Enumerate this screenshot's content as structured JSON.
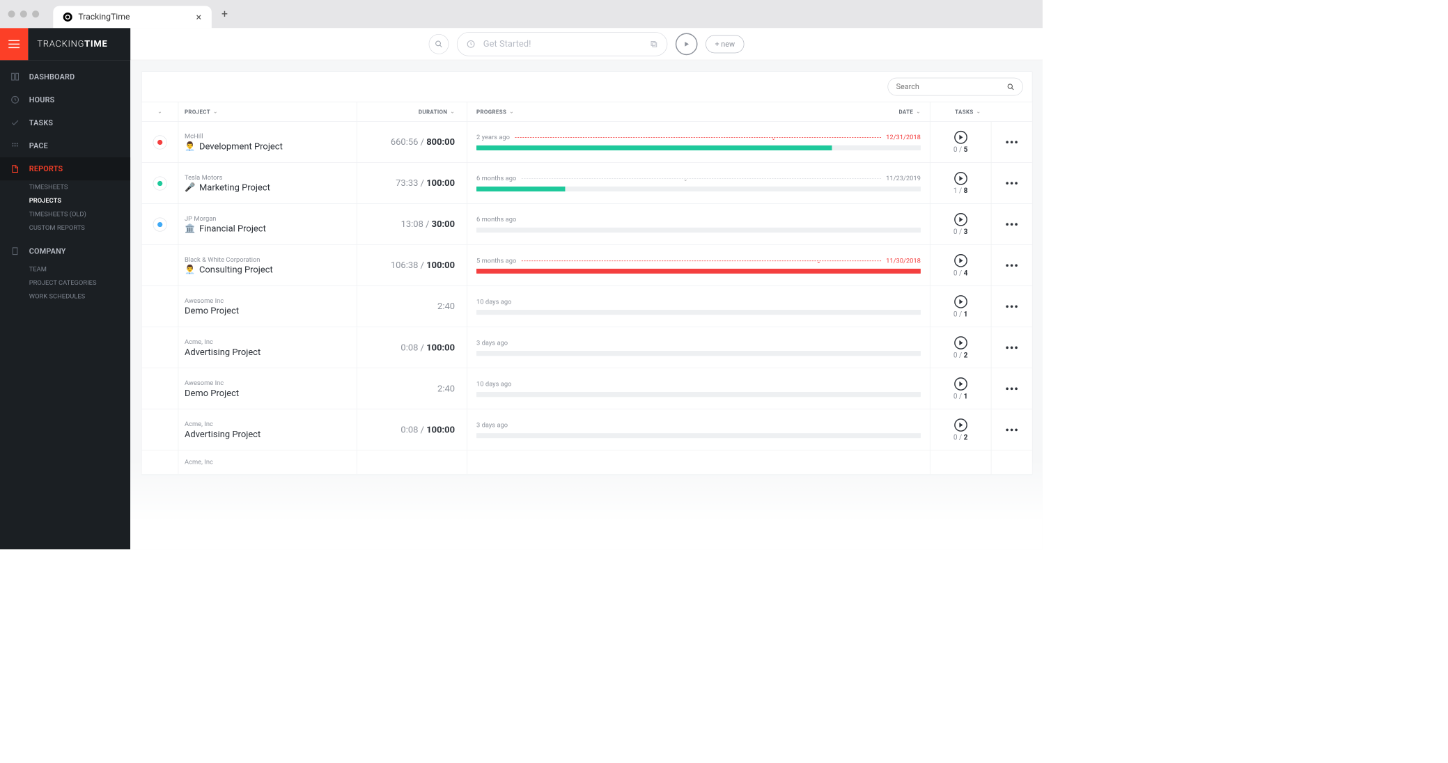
{
  "browser": {
    "tab_title": "TrackingTime"
  },
  "brand": {
    "part1": "TRACKING",
    "part2": "TIME"
  },
  "topbar": {
    "get_started": "Get Started!",
    "new_btn": "+ new"
  },
  "sidebar": {
    "items": [
      {
        "label": "DASHBOARD"
      },
      {
        "label": "HOURS"
      },
      {
        "label": "TASKS"
      },
      {
        "label": "PACE"
      },
      {
        "label": "REPORTS"
      },
      {
        "label": "COMPANY"
      }
    ],
    "reports_sub": [
      {
        "label": "TIMESHEETS"
      },
      {
        "label": "PROJECTS"
      },
      {
        "label": "TIMESHEETS (OLD)"
      },
      {
        "label": "CUSTOM REPORTS"
      }
    ],
    "company_sub": [
      {
        "label": "TEAM"
      },
      {
        "label": "PROJECT CATEGORIES"
      },
      {
        "label": "WORK SCHEDULES"
      }
    ]
  },
  "search": {
    "placeholder": "Search"
  },
  "columns": {
    "project": "PROJECT",
    "duration": "DURATION",
    "progress": "PROGRESS",
    "date": "DATE",
    "tasks": "TASKS"
  },
  "rows": [
    {
      "color": "#f43f3f",
      "client": "McHill",
      "emoji": "👨‍💼",
      "name": "Development Project",
      "dur": "660:56",
      "est": "800:00",
      "ago": "2 years ago",
      "date": "12/31/2018",
      "overdue": true,
      "fill": 80,
      "fillColor": "green",
      "tickPct": 70,
      "tasks_done": "0",
      "tasks_total": "5"
    },
    {
      "color": "#1ec99b",
      "client": "Tesla Motors",
      "emoji": "🎤",
      "name": "Marketing Project",
      "dur": "73:33",
      "est": "100:00",
      "ago": "6 months ago",
      "date": "11/23/2019",
      "overdue": false,
      "fill": 20,
      "fillColor": "green",
      "tickPct": 45,
      "tasks_done": "1",
      "tasks_total": "8"
    },
    {
      "color": "#3fa9f5",
      "client": "JP Morgan",
      "emoji": "🏛️",
      "name": "Financial Project",
      "dur": "13:08",
      "est": "30:00",
      "ago": "6 months ago",
      "date": "",
      "overdue": false,
      "fill": 0,
      "fillColor": "green",
      "tickPct": null,
      "tasks_done": "0",
      "tasks_total": "3"
    },
    {
      "color": "",
      "client": "Black & White Corporation",
      "emoji": "👨‍💼",
      "name": "Consulting Project",
      "dur": "106:38",
      "est": "100:00",
      "ago": "5 months ago",
      "date": "11/30/2018",
      "overdue": true,
      "fill": 100,
      "fillColor": "red",
      "tickPct": 82,
      "tasks_done": "0",
      "tasks_total": "4"
    },
    {
      "color": "",
      "client": "Awesome Inc",
      "emoji": "",
      "name": "Demo Project",
      "dur": "2:40",
      "est": "",
      "ago": "10 days ago",
      "date": "",
      "overdue": false,
      "fill": 0,
      "fillColor": "green",
      "tickPct": null,
      "tasks_done": "0",
      "tasks_total": "1"
    },
    {
      "color": "",
      "client": "Acme, Inc",
      "emoji": "",
      "name": "Advertising Project",
      "dur": "0:08",
      "est": "100:00",
      "ago": "3 days ago",
      "date": "",
      "overdue": false,
      "fill": 0,
      "fillColor": "green",
      "tickPct": null,
      "tasks_done": "0",
      "tasks_total": "2"
    },
    {
      "color": "",
      "client": "Awesome Inc",
      "emoji": "",
      "name": "Demo Project",
      "dur": "2:40",
      "est": "",
      "ago": "10 days ago",
      "date": "",
      "overdue": false,
      "fill": 0,
      "fillColor": "green",
      "tickPct": null,
      "tasks_done": "0",
      "tasks_total": "1"
    },
    {
      "color": "",
      "client": "Acme, Inc",
      "emoji": "",
      "name": "Advertising Project",
      "dur": "0:08",
      "est": "100:00",
      "ago": "3 days ago",
      "date": "",
      "overdue": false,
      "fill": 0,
      "fillColor": "green",
      "tickPct": null,
      "tasks_done": "0",
      "tasks_total": "2"
    },
    {
      "color": "",
      "client": "Acme, Inc",
      "emoji": "",
      "name": "",
      "dur": "",
      "est": "",
      "ago": "",
      "date": "",
      "overdue": false,
      "fill": 0,
      "fillColor": "green",
      "tickPct": null,
      "tasks_done": "",
      "tasks_total": ""
    }
  ]
}
